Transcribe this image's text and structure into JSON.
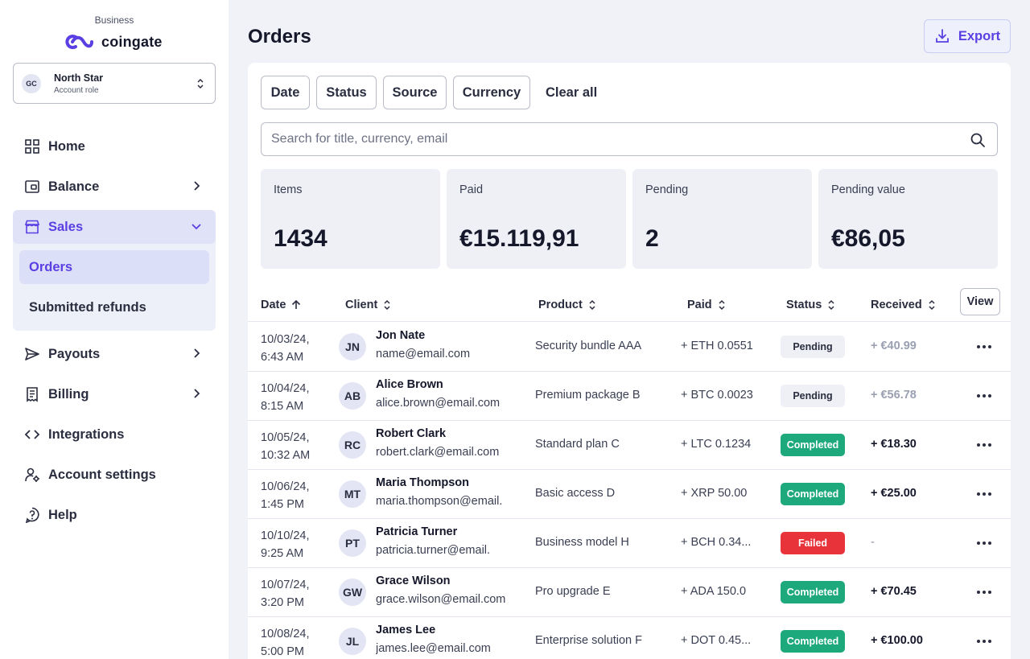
{
  "brand": {
    "subtitle": "Business",
    "name": "coingate"
  },
  "account": {
    "initials": "GC",
    "name": "North Star",
    "role": "Account role"
  },
  "nav": {
    "home": "Home",
    "balance": "Balance",
    "sales": "Sales",
    "orders": "Orders",
    "refunds": "Submitted refunds",
    "payouts": "Payouts",
    "billing": "Billing",
    "integrations": "Integrations",
    "account_settings": "Account settings",
    "help": "Help"
  },
  "page": {
    "title": "Orders",
    "export_label": "Export"
  },
  "filters": {
    "date": "Date",
    "status": "Status",
    "source": "Source",
    "currency": "Currency",
    "clear": "Clear all"
  },
  "search": {
    "placeholder": "Search for title, currency, email"
  },
  "stats": [
    {
      "label": "Items",
      "value": "1434"
    },
    {
      "label": "Paid",
      "value": "€15.119,91"
    },
    {
      "label": "Pending",
      "value": "2"
    },
    {
      "label": "Pending value",
      "value": "€86,05"
    }
  ],
  "table": {
    "headers": {
      "date": "Date",
      "client": "Client",
      "product": "Product",
      "paid": "Paid",
      "status": "Status",
      "received": "Received"
    },
    "view_label": "View",
    "rows": [
      {
        "date1": "10/03/24,",
        "date2": "6:43 AM",
        "initials": "JN",
        "name": "Jon Nate",
        "email": "name@email.com",
        "product": "Security bundle AAA",
        "paid": "+ ETH 0.0551",
        "status": "Pending",
        "received": "+ €40.99"
      },
      {
        "date1": "10/04/24,",
        "date2": "8:15 AM",
        "initials": "AB",
        "name": "Alice Brown",
        "email": "alice.brown@email.com",
        "product": "Premium package B",
        "paid": "+ BTC 0.0023",
        "status": "Pending",
        "received": "+ €56.78"
      },
      {
        "date1": "10/05/24,",
        "date2": "10:32 AM",
        "initials": "RC",
        "name": "Robert Clark",
        "email": "robert.clark@email.com",
        "product": "Standard plan C",
        "paid": "+ LTC 0.1234",
        "status": "Completed",
        "received": "+ €18.30"
      },
      {
        "date1": "10/06/24,",
        "date2": "1:45 PM",
        "initials": "MT",
        "name": "Maria Thompson",
        "email": "maria.thompson@email.",
        "product": "Basic access D",
        "paid": "+ XRP 50.00",
        "status": "Completed",
        "received": "+ €25.00"
      },
      {
        "date1": "10/10/24,",
        "date2": "9:25 AM",
        "initials": "PT",
        "name": "Patricia Turner",
        "email": "patricia.turner@email.",
        "product": "Business model H",
        "paid": "+ BCH 0.34...",
        "status": "Failed",
        "received": "-"
      },
      {
        "date1": "10/07/24,",
        "date2": "3:20 PM",
        "initials": "GW",
        "name": "Grace Wilson",
        "email": "grace.wilson@email.com",
        "product": "Pro upgrade E",
        "paid": "+ ADA 150.0",
        "status": "Completed",
        "received": "+ €70.45"
      },
      {
        "date1": "10/08/24,",
        "date2": "5:00 PM",
        "initials": "JL",
        "name": "James Lee",
        "email": "james.lee@email.com",
        "product": "Enterprise solution F",
        "paid": "+ DOT 0.45...",
        "status": "Completed",
        "received": "+ €100.00"
      }
    ]
  },
  "colors": {
    "accent": "#5b3fe3",
    "completed": "#1ea97c",
    "failed": "#e8333a"
  }
}
